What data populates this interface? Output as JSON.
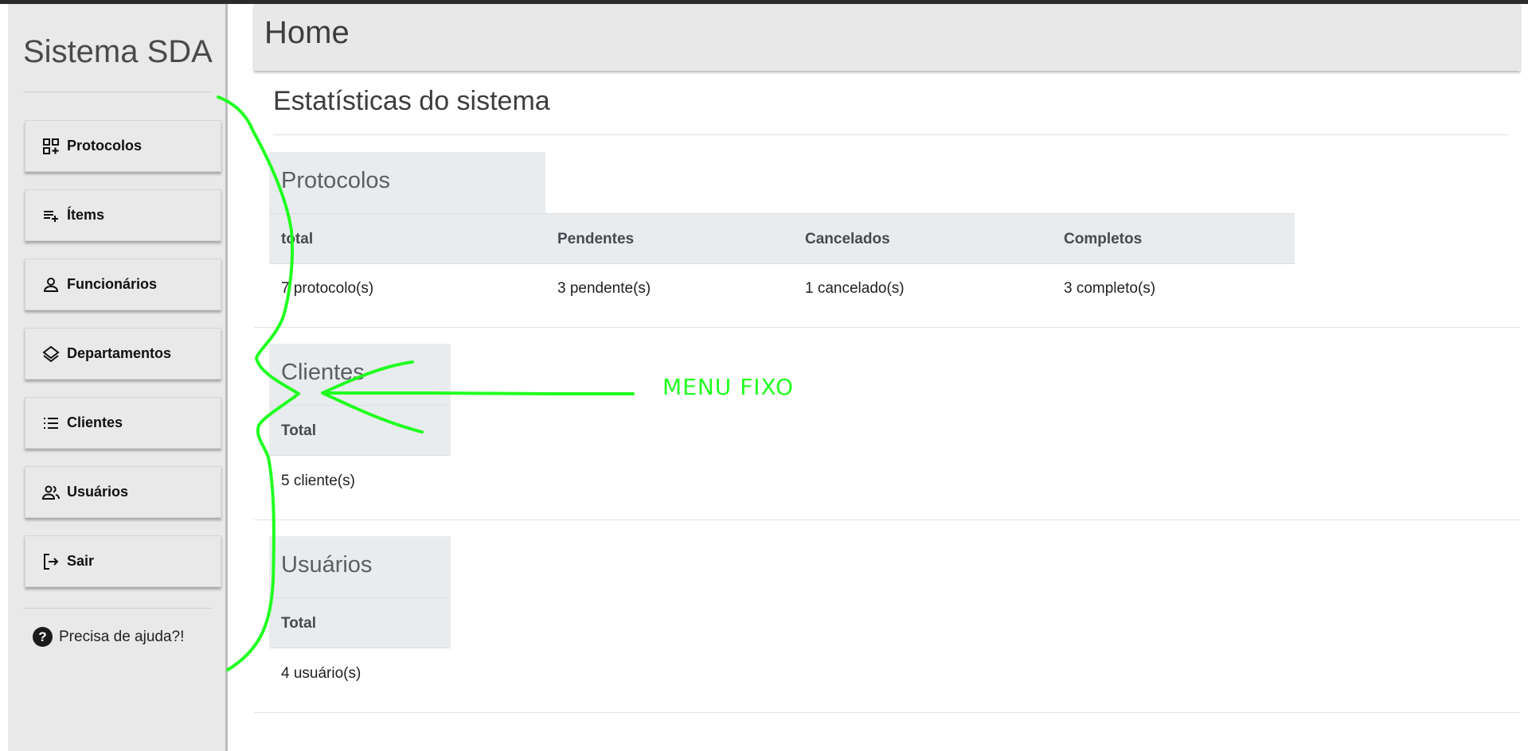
{
  "sidebar": {
    "brand": "Sistema SDA",
    "items": [
      {
        "label": "Protocolos",
        "icon": "dashboard-add-icon"
      },
      {
        "label": "Ítems",
        "icon": "playlist-add-icon"
      },
      {
        "label": "Funcionários",
        "icon": "person-icon"
      },
      {
        "label": "Departamentos",
        "icon": "layers-icon"
      },
      {
        "label": "Clientes",
        "icon": "list-icon"
      },
      {
        "label": "Usuários",
        "icon": "people-icon"
      },
      {
        "label": "Sair",
        "icon": "logout-icon"
      }
    ],
    "help": {
      "label": "Precisa de ajuda?!",
      "icon": "help-circle-icon"
    }
  },
  "header": {
    "title": "Home"
  },
  "main": {
    "section_title": "Estatísticas do sistema",
    "protocolos": {
      "title": "Protocolos",
      "columns": [
        "total",
        "Pendentes",
        "Cancelados",
        "Completos"
      ],
      "values": [
        "7 protocolo(s)",
        "3 pendente(s)",
        "1 cancelado(s)",
        "3 completo(s)"
      ]
    },
    "clientes": {
      "title": "Clientes",
      "column": "Total",
      "value": "5 cliente(s)"
    },
    "usuarios": {
      "title": "Usuários",
      "column": "Total",
      "value": "4 usuário(s)"
    }
  },
  "annotation": {
    "label": "MENU FIXO",
    "color": "#22ff22"
  }
}
